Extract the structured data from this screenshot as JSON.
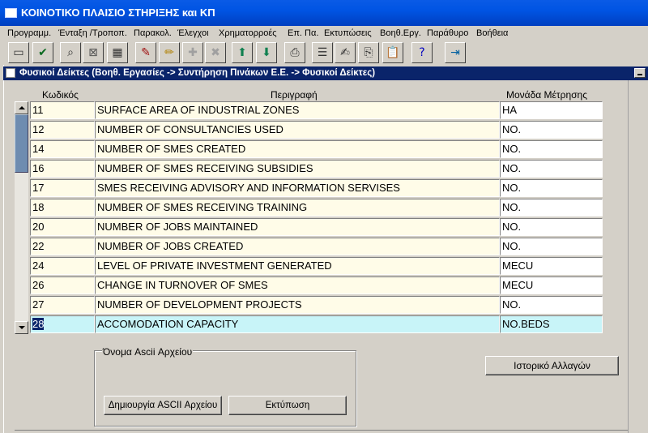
{
  "window": {
    "title": "ΚΟΙΝΟΤΙΚΟ ΠΛΑΙΣΙΟ ΣΤΗΡΙΞΗΣ και ΚΠ"
  },
  "menu": [
    "Προγραμμ.",
    "Ένταξη /Τροποπ.",
    "Παρακολ.",
    "Έλεγχοι",
    "Χρηματορροές",
    "Επ. Πα.",
    "Εκτυπώσεις",
    "Βοηθ.Εργ.",
    "Παράθυρο",
    "Βοήθεια"
  ],
  "toolbar": [
    {
      "icon": "save-icon",
      "glyph": "▭",
      "color": "#333333"
    },
    {
      "icon": "accept-icon",
      "glyph": "✔",
      "color": "#0a6a20"
    },
    {
      "icon": "enter-query-icon",
      "glyph": "⌕",
      "color": "#333333"
    },
    {
      "icon": "cancel-query-icon",
      "glyph": "⊠",
      "color": "#555555"
    },
    {
      "icon": "execute-query-icon",
      "glyph": "▦",
      "color": "#333333"
    },
    {
      "icon": "clear-icon",
      "glyph": "✎",
      "color": "#a01010"
    },
    {
      "icon": "edit-icon",
      "glyph": "✏",
      "color": "#b08000"
    },
    {
      "icon": "insert-record-icon",
      "glyph": "✚",
      "color": "#a0a0a0"
    },
    {
      "icon": "delete-record-icon",
      "glyph": "✖",
      "color": "#a0a0a0"
    },
    {
      "icon": "previous-record-icon",
      "glyph": "⬆",
      "color": "#108050"
    },
    {
      "icon": "next-record-icon",
      "glyph": "⬇",
      "color": "#108050"
    },
    {
      "icon": "print-icon",
      "glyph": "⎙",
      "color": "#333333"
    },
    {
      "icon": "list-icon",
      "glyph": "☰",
      "color": "#333333"
    },
    {
      "icon": "edit-document-icon",
      "glyph": "✍",
      "color": "#333333"
    },
    {
      "icon": "copy-icon",
      "glyph": "⎘",
      "color": "#333333"
    },
    {
      "icon": "paste-icon",
      "glyph": "📋",
      "color": "#333333"
    },
    {
      "icon": "help-icon",
      "glyph": "?",
      "color": "#0000c0"
    },
    {
      "icon": "exit-icon",
      "glyph": "⇥",
      "color": "#0060a0"
    }
  ],
  "form": {
    "title": "Φυσικοί Δείκτες (Βοηθ. Εργασίες -> Συντήρηση Πινάκων Ε.Ε. -> Φυσικοί Δείκτες)",
    "columns": {
      "code": "Κωδικός",
      "description": "Περιγραφή",
      "unit": "Μονάδα Μέτρησης"
    },
    "rows": [
      {
        "code": "11",
        "description": "SURFACE AREA OF INDUSTRIAL ZONES",
        "unit": "HA"
      },
      {
        "code": "12",
        "description": "NUMBER OF CONSULTANCIES USED",
        "unit": "NO."
      },
      {
        "code": "14",
        "description": "NUMBER OF SMES CREATED",
        "unit": "NO."
      },
      {
        "code": "16",
        "description": "NUMBER OF SMES RECEIVING SUBSIDIES",
        "unit": "NO."
      },
      {
        "code": "17",
        "description": "SMES RECEIVING ADVISORY AND INFORMATION SERVISES",
        "unit": "NO."
      },
      {
        "code": "18",
        "description": "NUMBER OF SMES RECEIVING TRAINING",
        "unit": "NO."
      },
      {
        "code": "20",
        "description": "NUMBER OF JOBS MAINTAINED",
        "unit": "NO."
      },
      {
        "code": "22",
        "description": "NUMBER OF JOBS CREATED",
        "unit": "NO."
      },
      {
        "code": "24",
        "description": "LEVEL OF PRIVATE INVESTMENT GENERATED",
        "unit": "MECU"
      },
      {
        "code": "26",
        "description": "CHANGE IN TURNOVER OF SMES",
        "unit": "MECU"
      },
      {
        "code": "27",
        "description": "NUMBER OF DEVELOPMENT PROJECTS",
        "unit": "NO."
      },
      {
        "code": "28",
        "description": "ACCOMODATION CAPACITY",
        "unit": "NO.BEDS"
      }
    ],
    "ascii_group_label": "Όνομα Ascii Αρχείου",
    "create_ascii_button": "Δημιουργία  ASCII Αρχείου",
    "print_button": "Εκτύπωση",
    "history_button": "Ιστορικό Αλλαγών"
  }
}
